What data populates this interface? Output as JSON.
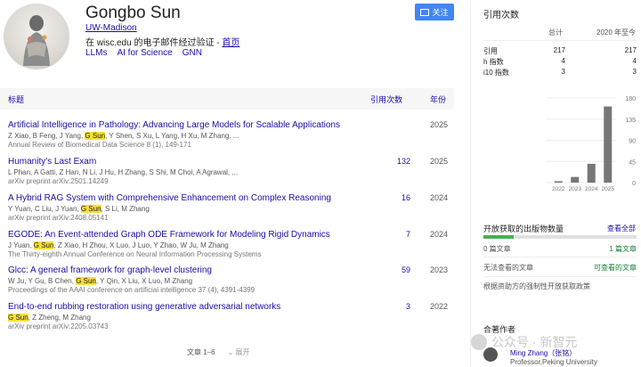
{
  "profile": {
    "name": "Gongbo Sun",
    "affiliation": "UW-Madison",
    "email_text": "在 wisc.edu 的电子邮件经过验证 - ",
    "homepage": "首页",
    "follow_label": "关注",
    "tags": [
      "LLMs",
      "AI for Science",
      "GNN"
    ]
  },
  "table": {
    "col_title": "标题",
    "col_cited": "引用次数",
    "col_year": "年份"
  },
  "publications": [
    {
      "title": "Artificial Intelligence in Pathology: Advancing Large Models for Scalable Applications",
      "authors_pre": "Z Xiao, B Feng, J Yang, ",
      "authors_hl": "G Sun",
      "authors_post": ", Y Shen, S Xu, L Yang, H Xu, M Zhang, ...",
      "venue": "Annual Review of Biomedical Data Science 8 (1), 149-171",
      "cited": "",
      "year": "2025"
    },
    {
      "title": "Humanity's Last Exam",
      "authors_pre": "L Phan, A Gatti, Z Han, N Li, J Hu, H Zhang, S Shi, M Choi, A Agrawal, ...",
      "authors_hl": "",
      "authors_post": "",
      "venue": "arXiv preprint arXiv:2501.14249",
      "cited": "132",
      "year": "2025"
    },
    {
      "title": "A Hybrid RAG System with Comprehensive Enhancement on Complex Reasoning",
      "authors_pre": "Y Yuan, C Liu, J Yuan, ",
      "authors_hl": "G Sun",
      "authors_post": ", S Li, M Zhang",
      "venue": "arXiv preprint arXiv:2408.05141",
      "cited": "16",
      "year": "2024"
    },
    {
      "title": "EGODE: An Event-attended Graph ODE Framework for Modeling Rigid Dynamics",
      "authors_pre": "J Yuan, ",
      "authors_hl": "G Sun",
      "authors_post": ", Z Xiao, H Zhou, X Luo, J Luo, Y Zhao, W Ju, M Zhang",
      "venue": "The Thirty-eighth Annual Conference on Neural Information Processing Systems",
      "cited": "7",
      "year": "2024"
    },
    {
      "title": "Glcc: A general framework for graph-level clustering",
      "authors_pre": "W Ju, Y Gu, B Chen, ",
      "authors_hl": "G Sun",
      "authors_post": ", Y Qin, X Liu, X Luo, M Zhang",
      "venue": "Proceedings of the AAAI conference on artificial intelligence 37 (4), 4391-4399",
      "cited": "59",
      "year": "2023"
    },
    {
      "title": "End-to-end rubbing restoration using generative adversarial networks",
      "authors_pre": "",
      "authors_hl": "G Sun",
      "authors_post": ", Z Zheng, M Zhang",
      "venue": "arXiv preprint arXiv:2205.03743",
      "cited": "3",
      "year": "2022"
    }
  ],
  "pager": {
    "range": "文章 1–6",
    "more": "展开"
  },
  "citations": {
    "title": "引用次数",
    "col_all": "总计",
    "col_since": "2020 年至今",
    "rows": [
      {
        "label": "引用",
        "all": "217",
        "since": "217"
      },
      {
        "label": "h 指数",
        "all": "4",
        "since": "4"
      },
      {
        "label": "i10 指数",
        "all": "3",
        "since": "3"
      }
    ]
  },
  "chart_data": {
    "type": "bar",
    "categories": [
      "2022",
      "2023",
      "2024",
      "2025"
    ],
    "values": [
      3,
      12,
      40,
      162
    ],
    "yticks": [
      "0",
      "45",
      "90",
      "135",
      "180"
    ],
    "ylim": [
      0,
      180
    ],
    "bar_color": "#777777"
  },
  "open_access": {
    "title": "开放获取的出版物数量",
    "view_all": "查看全部",
    "unavailable": "0 篇文章",
    "available": "1 篇文章",
    "unavailable_label": "无法查看的文章",
    "available_label": "可查看的文章",
    "note": "根据资助方的强制性开放获取政策",
    "fill_fraction": 0.2
  },
  "coauthors": {
    "title": "合著作者",
    "items": [
      {
        "name": "Ming Zhang（张铭）",
        "affiliation": "Professor,Peking University"
      }
    ]
  },
  "watermark": "公众号 · 新智元",
  "colors": {
    "link": "#1a0dab",
    "highlight": "#f8de3b",
    "accent": "#4285f4",
    "green": "#4caf50"
  }
}
